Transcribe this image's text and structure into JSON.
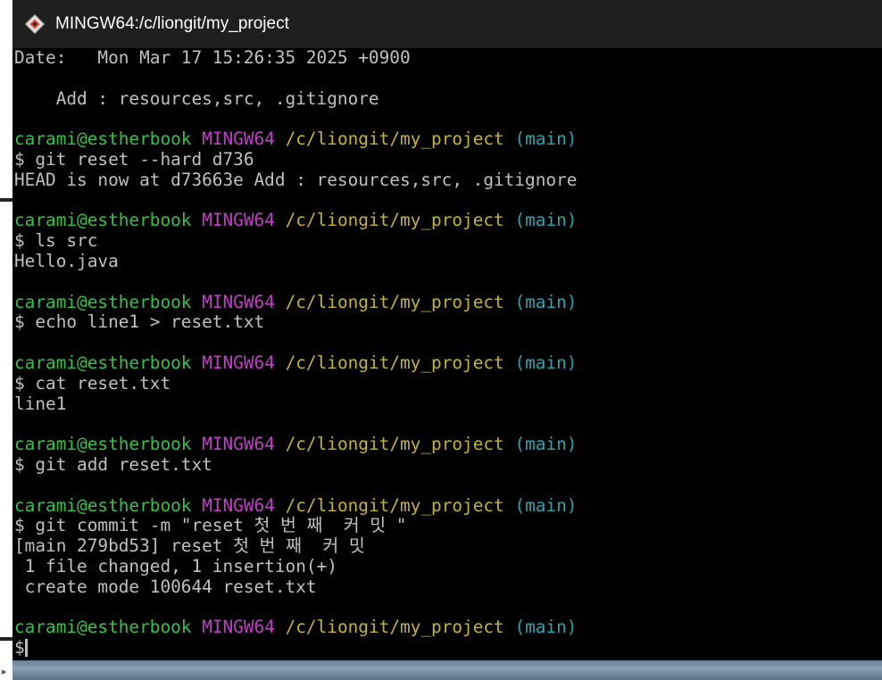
{
  "window": {
    "title": "MINGW64:/c/liongit/my_project",
    "icon": "git-bash-diamond-icon"
  },
  "colors": {
    "user": "#35c24a",
    "host": "#c13fc6",
    "path": "#c4b433",
    "branch": "#25a7b0",
    "text": "#c0c0c0"
  },
  "prompt": {
    "user": "carami@estherbook",
    "host": "MINGW64",
    "path": "/c/liongit/my_project",
    "branch": "(main)"
  },
  "terminal_lines": [
    {
      "type": "text",
      "text": "Date:   Mon Mar 17 15:26:35 2025 +0900"
    },
    {
      "type": "text",
      "text": ""
    },
    {
      "type": "text",
      "text": "    Add : resources,src, .gitignore"
    },
    {
      "type": "text",
      "text": ""
    },
    {
      "type": "prompt"
    },
    {
      "type": "text",
      "text": "$ git reset --hard d736"
    },
    {
      "type": "text",
      "text": "HEAD is now at d73663e Add : resources,src, .gitignore"
    },
    {
      "type": "text",
      "text": ""
    },
    {
      "type": "prompt"
    },
    {
      "type": "text",
      "text": "$ ls src"
    },
    {
      "type": "text",
      "text": "Hello.java"
    },
    {
      "type": "text",
      "text": ""
    },
    {
      "type": "prompt"
    },
    {
      "type": "text",
      "text": "$ echo line1 > reset.txt"
    },
    {
      "type": "text",
      "text": ""
    },
    {
      "type": "prompt"
    },
    {
      "type": "text",
      "text": "$ cat reset.txt"
    },
    {
      "type": "text",
      "text": "line1"
    },
    {
      "type": "text",
      "text": ""
    },
    {
      "type": "prompt"
    },
    {
      "type": "text",
      "text": "$ git add reset.txt"
    },
    {
      "type": "text",
      "text": ""
    },
    {
      "type": "prompt"
    },
    {
      "type": "text",
      "text": "$ git commit -m \"reset 첫 번 째  커 밋 \""
    },
    {
      "type": "text",
      "text": "[main 279bd53] reset 첫 번 째  커 밋"
    },
    {
      "type": "text",
      "text": " 1 file changed, 1 insertion(+)"
    },
    {
      "type": "text",
      "text": " create mode 100644 reset.txt"
    },
    {
      "type": "text",
      "text": ""
    },
    {
      "type": "prompt"
    },
    {
      "type": "input",
      "text": "$"
    }
  ]
}
